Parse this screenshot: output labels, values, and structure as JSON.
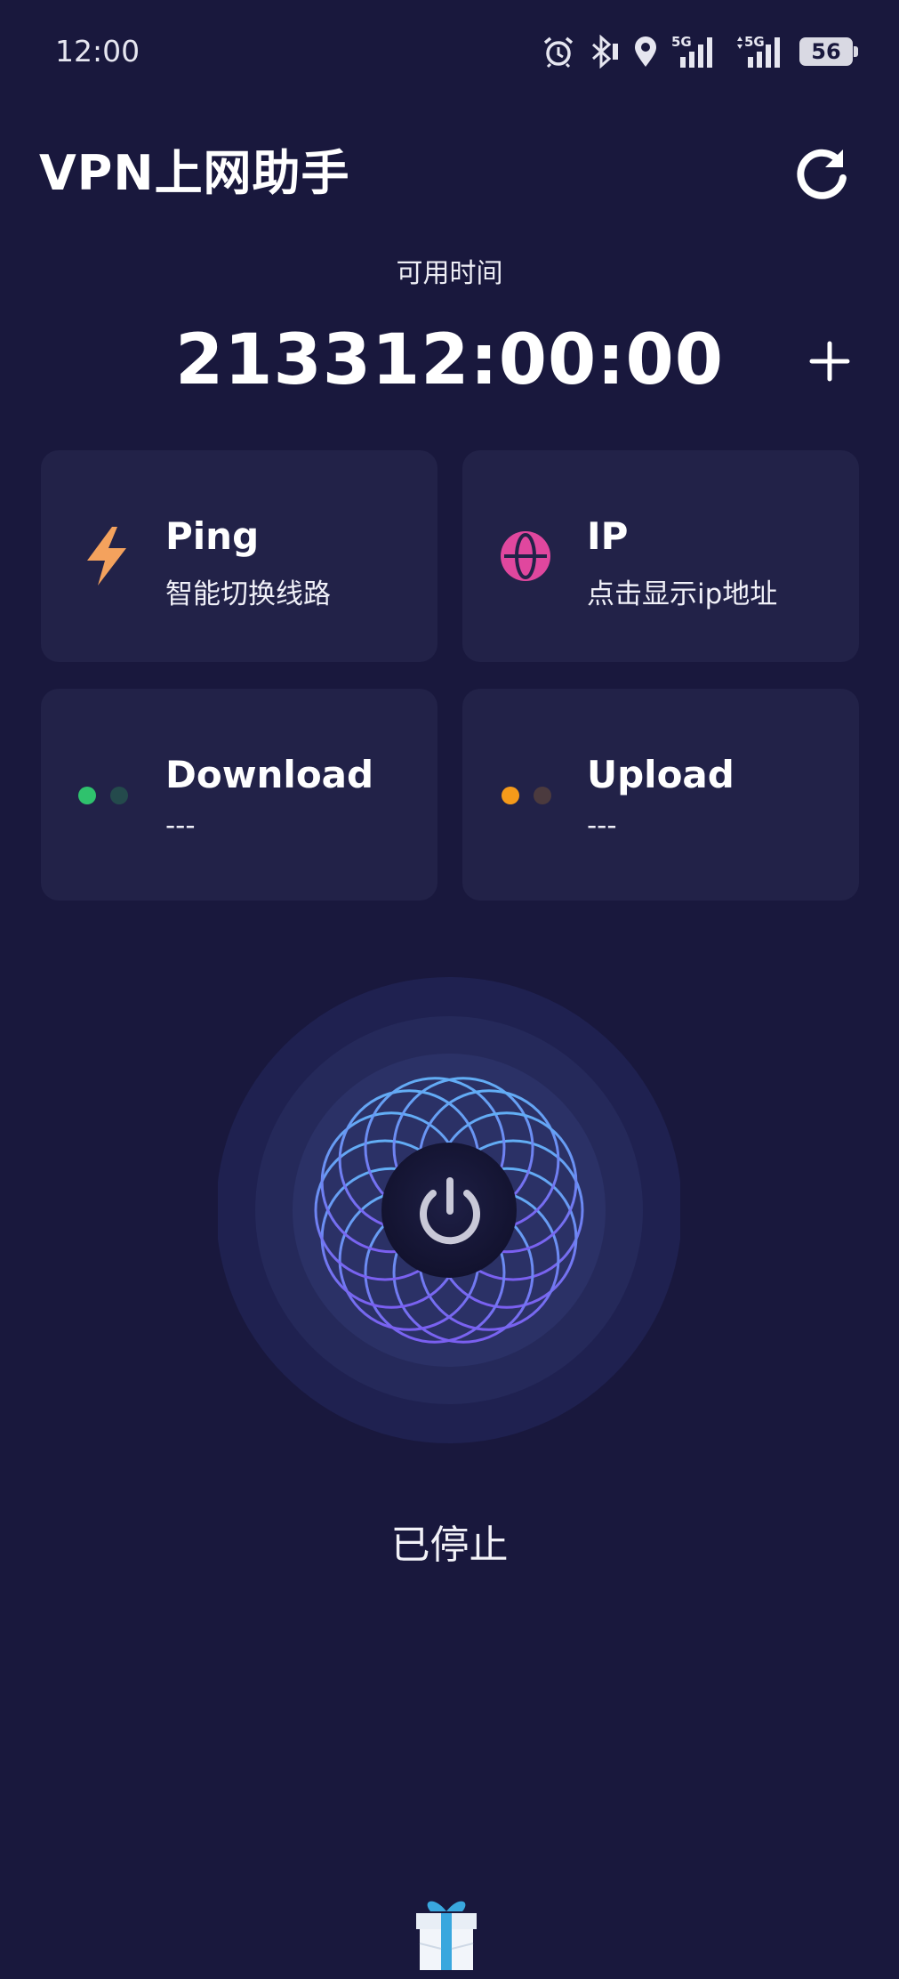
{
  "status_bar": {
    "time": "12:00",
    "icons": [
      "alarm-icon",
      "bluetooth-icon",
      "location-icon",
      "signal-5g-icon",
      "signal-5g-data-icon"
    ],
    "net1": "5G",
    "net2": "5G",
    "battery": "56"
  },
  "header": {
    "title": "VPN上网助手",
    "refresh_icon": "refresh-icon"
  },
  "timer": {
    "label": "可用时间",
    "value": "213312:00:00",
    "add_icon": "plus-icon"
  },
  "cards": {
    "ping": {
      "title": "Ping",
      "subtitle": "智能切换线路",
      "icon": "lightning-icon",
      "color": "#f4a25d"
    },
    "ip": {
      "title": "IP",
      "subtitle": "点击显示ip地址",
      "icon": "globe-icon",
      "color": "#e0479e"
    },
    "download": {
      "title": "Download",
      "value": "---",
      "icon": "download-dots-icon",
      "color": "#2fc26d"
    },
    "upload": {
      "title": "Upload",
      "value": "---",
      "icon": "upload-dots-icon",
      "color": "#f59a1a"
    }
  },
  "connection": {
    "status": "已停止",
    "power_icon": "power-icon"
  },
  "footer": {
    "gift_icon": "gift-icon"
  },
  "colors": {
    "background": "#19183d",
    "card": "#222248",
    "accent": "#6f7cf0"
  }
}
